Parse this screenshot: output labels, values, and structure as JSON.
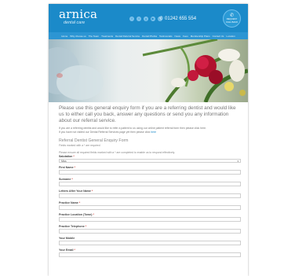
{
  "brand": {
    "name": "arnica",
    "tagline": "dental care",
    "header_color": "#1b8ac9",
    "nav_color": "#2c95d3"
  },
  "header": {
    "phone": "01242 655 554",
    "callback_label": "REQUEST CALL BACK",
    "socials": [
      "facebook-icon",
      "twitter-icon",
      "google-plus-icon",
      "youtube-icon",
      "instagram-icon"
    ]
  },
  "nav": {
    "items": [
      "Home",
      "Why choose us",
      "The Team",
      "Treatments",
      "Dental Referral Service",
      "Dental Phobia",
      "Testimonials",
      "News",
      "Fees",
      "Membership Plans",
      "Contact Us",
      "Location"
    ]
  },
  "content": {
    "intro": "Please use this general enquiry form if you are a referring dentist and would like us to either call you back, answer any questions or send you any information about our referral service.",
    "referral_line": "If you are a referring dentist and would like to refer a patient to us using our online patient referral form then please click here.",
    "visited_line_prefix": "If you have not visited our Dental Referral Services page yet then please click ",
    "visited_link": "here",
    "form_title": "Referral Dentist General Enquiry Form",
    "required_note": "Fields marked with a * are required",
    "ensure_note": "Please ensure all required fields marked with a * are completed to enable us to respond effectively."
  },
  "form": {
    "salutation_label": "Salutation",
    "salutation_value": "Miss",
    "fields": [
      {
        "label": "First Name",
        "required": "*"
      },
      {
        "label": "Surname",
        "required": "*"
      },
      {
        "label": "Letters After Your Name",
        "required": "*"
      },
      {
        "label": "Practice Name",
        "required": "*"
      },
      {
        "label": "Practice Location (Town)",
        "required": "*"
      },
      {
        "label": "Practice Telephone",
        "required": "*"
      },
      {
        "label": "Your Mobile",
        "required": ""
      },
      {
        "label": "Your Email",
        "required": "*"
      }
    ]
  }
}
